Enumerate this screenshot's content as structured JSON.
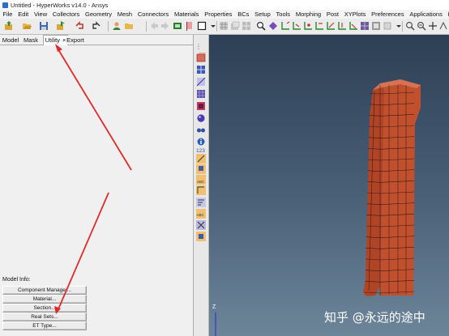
{
  "window": {
    "title": "Untitled - HyperWorks v14.0 - Ansys"
  },
  "menu": [
    "File",
    "Edit",
    "View",
    "Collectors",
    "Geometry",
    "Mesh",
    "Connectors",
    "Materials",
    "Properties",
    "BCs",
    "Setup",
    "Tools",
    "Morphing",
    "Post",
    "XYPlots",
    "Preferences",
    "Applications",
    "He"
  ],
  "tabs": [
    {
      "label": "Model"
    },
    {
      "label": "Mask"
    },
    {
      "label": "Utility",
      "close": "×"
    },
    {
      "label": "Export"
    }
  ],
  "utility": {
    "section_label": "Model Info:",
    "buttons": [
      "Component Manager...",
      "Material...",
      "Section...",
      "Real Sets...",
      "ET Type..."
    ]
  },
  "viewport": {
    "axis_label": "Z",
    "watermark": "知乎 @永远的途中"
  },
  "colors": {
    "mesh_face": "#c0502e",
    "mesh_side": "#9e3e22",
    "mesh_line": "#3a1a10",
    "annotation_arrow": "#e02a2a"
  },
  "icons": [
    "import-icon",
    "open-icon",
    "save-icon",
    "export-icon",
    "undo-icon",
    "user-icon",
    "folder-icon",
    "arrow-left-icon",
    "arrow-right-icon",
    "display-icon",
    "rectangle-icon",
    "zoom-icon",
    "rotate-icon",
    "fit-icon",
    "mesh-shade-icon",
    "view-icon",
    "cursor-icon"
  ]
}
